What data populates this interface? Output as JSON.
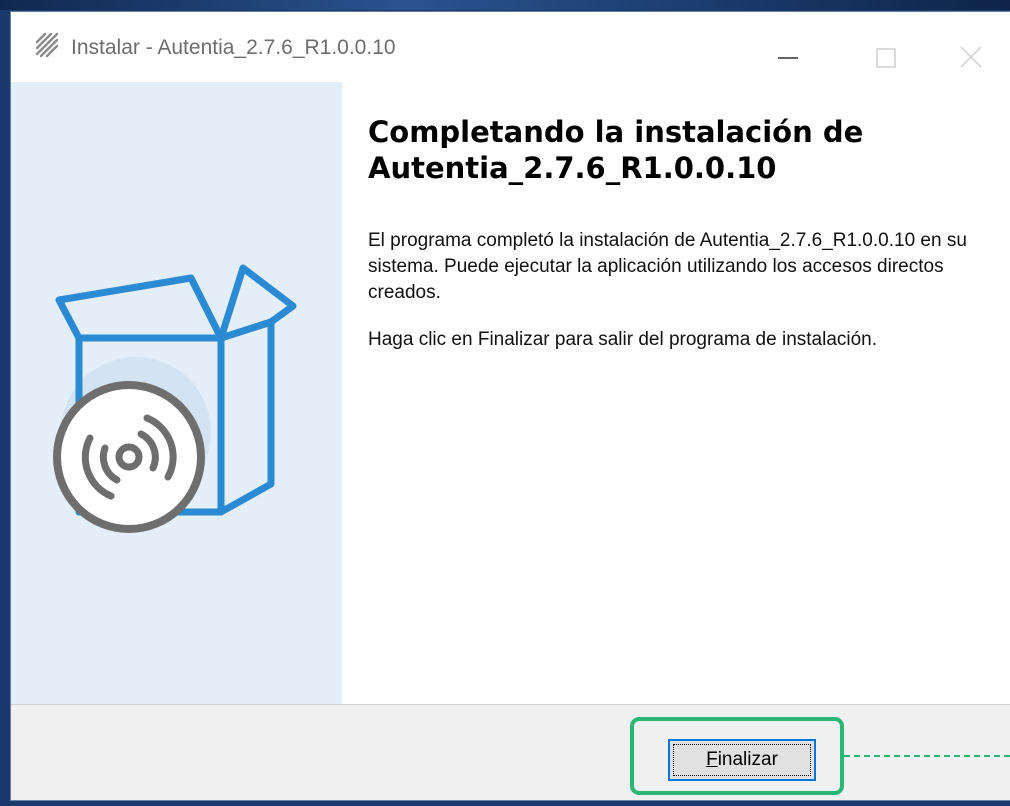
{
  "window": {
    "title": "Instalar - Autentia_2.7.6_R1.0.0.10",
    "icon": "installer-app-icon",
    "controls": [
      "minimize-icon",
      "maximize-icon",
      "close-icon"
    ]
  },
  "sidepanel": {
    "graphic": "box-with-disc-illustration",
    "accent_color": "#2a8ad4",
    "disc_color": "#6e6e6e"
  },
  "content": {
    "heading_line1": "Completando la instalación de",
    "heading_line2": "Autentia_2.7.6_R1.0.0.10",
    "paragraph1": "El programa completó la instalación de Autentia_2.7.6_R1.0.0.10 en su sistema. Puede ejecutar la aplicación utilizando los accesos directos creados.",
    "paragraph2": "Haga clic en Finalizar para salir del programa de instalación."
  },
  "footer": {
    "finish_button": {
      "accel": "F",
      "rest": "inalizar",
      "label": "Finalizar"
    }
  },
  "colors": {
    "highlight": "#2ab673",
    "button_focus": "#0078d7"
  }
}
